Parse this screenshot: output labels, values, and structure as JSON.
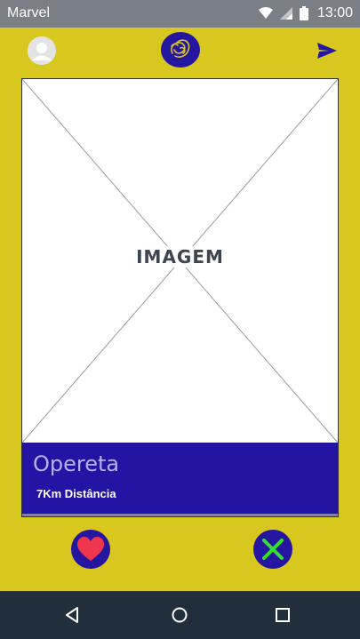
{
  "status_bar": {
    "carrier": "Marvel",
    "time": "13:00",
    "icons": [
      "wifi-icon",
      "signal-icon",
      "battery-icon"
    ]
  },
  "top_bar": {
    "left_icon": "avatar-icon",
    "center_icon": "logo-icon",
    "right_icon": "send-icon"
  },
  "card": {
    "image_placeholder_text": "IMAGEM",
    "name": "Opereta",
    "distance": "7Km Distância"
  },
  "actions": {
    "like_icon": "heart-icon",
    "dislike_icon": "close-icon"
  },
  "nav_bar": {
    "icons": [
      "back-icon",
      "home-icon",
      "recent-apps-icon"
    ]
  },
  "colors": {
    "background": "#d8c71e",
    "accent": "#2416a0",
    "heart": "#f0364f",
    "close": "#34e02c",
    "status_bar": "#7a7f86",
    "nav_bar": "#212f3d"
  }
}
